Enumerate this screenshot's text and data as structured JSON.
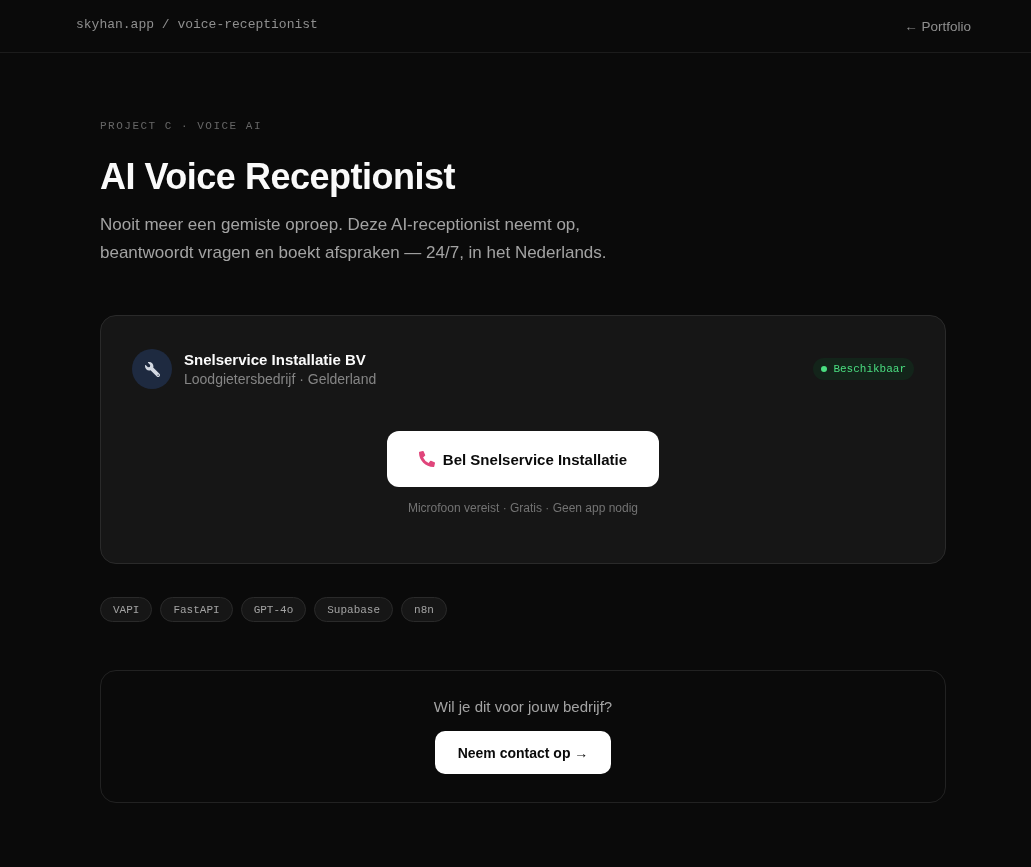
{
  "header": {
    "breadcrumb": "skyhan.app / voice-receptionist",
    "back_link": "← Portfolio"
  },
  "hero": {
    "eyebrow": "PROJECT C · VOICE AI",
    "title": "AI Voice Receptionist",
    "description": "Nooit meer een gemiste oproep. Deze AI-receptionist neemt op, beantwoordt vragen en boekt afspraken — 24/7, in het Nederlands."
  },
  "demo_card": {
    "business_name": "Snelservice Installatie BV",
    "business_details": "Loodgietersbedrijf · Gelderland",
    "status_badge": "Beschikbaar",
    "call_button": "Bel Snelservice Installatie",
    "call_note": "Microfoon vereist · Gratis · Geen app nodig"
  },
  "tech_tags": [
    "VAPI",
    "FastAPI",
    "GPT-4o",
    "Supabase",
    "n8n"
  ],
  "cta": {
    "question": "Wil je dit voor jouw bedrijf?",
    "button": "Neem contact op →"
  }
}
